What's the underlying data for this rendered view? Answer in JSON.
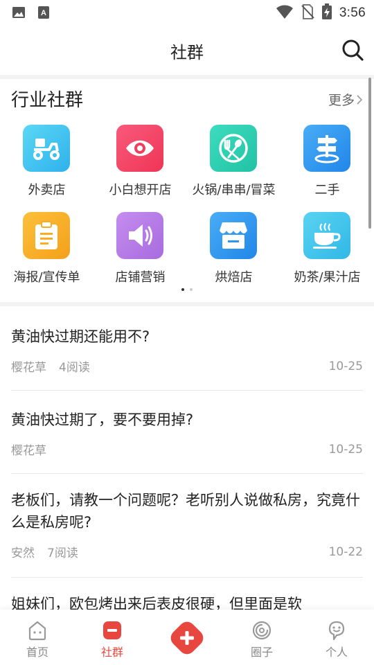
{
  "status_bar": {
    "time": "3:56",
    "icons": [
      "image-icon",
      "a-icon",
      "wifi-icon",
      "no-sim-icon",
      "battery-charging-icon"
    ]
  },
  "header": {
    "title": "社群",
    "search_icon": "search-icon"
  },
  "industry": {
    "title": "行业社群",
    "more_label": "更多",
    "items": [
      {
        "label": "外卖店",
        "icon": "delivery-scooter-icon",
        "color": "#3fc3f0"
      },
      {
        "label": "小白想开店",
        "icon": "eye-icon",
        "color": "#f44a6b"
      },
      {
        "label": "火锅/串串/冒菜",
        "icon": "dining-plate-icon",
        "color": "#2fcfb3"
      },
      {
        "label": "二手",
        "icon": "signpost-icon",
        "color": "#2e9bf0"
      },
      {
        "label": "海报/宣传单",
        "icon": "clipboard-icon",
        "color": "#f8ae2a"
      },
      {
        "label": "店铺营销",
        "icon": "speaker-icon",
        "color": "#b77ee6"
      },
      {
        "label": "烘焙店",
        "icon": "storefront-icon",
        "color": "#2e9bf0"
      },
      {
        "label": "奶茶/果汁店",
        "icon": "teacup-icon",
        "color": "#41c6ea"
      }
    ]
  },
  "posts": [
    {
      "title": "黄油快过期还能用不?",
      "author": "樱花草",
      "reads": "4阅读",
      "date": "10-25"
    },
    {
      "title": "黄油快过期了，要不要用掉?",
      "author": "樱花草",
      "reads": "",
      "date": "10-25"
    },
    {
      "title": "老板们，请教一个问题呢？老听别人说做私房，究竟什么是私房呢?",
      "author": "安然",
      "reads": "7阅读",
      "date": "10-22"
    },
    {
      "title": "姐妹们，欧包烤出来后表皮很硬，但里面是软",
      "author": "",
      "reads": "",
      "date": ""
    }
  ],
  "tabbar": {
    "tabs": [
      {
        "label": "首页",
        "icon": "home-icon"
      },
      {
        "label": "社群",
        "icon": "community-icon"
      },
      {
        "label": "",
        "icon": "plus-icon"
      },
      {
        "label": "圈子",
        "icon": "circle-icon"
      },
      {
        "label": "个人",
        "icon": "profile-icon"
      }
    ],
    "active": "社群",
    "accent": "#e8473f"
  }
}
